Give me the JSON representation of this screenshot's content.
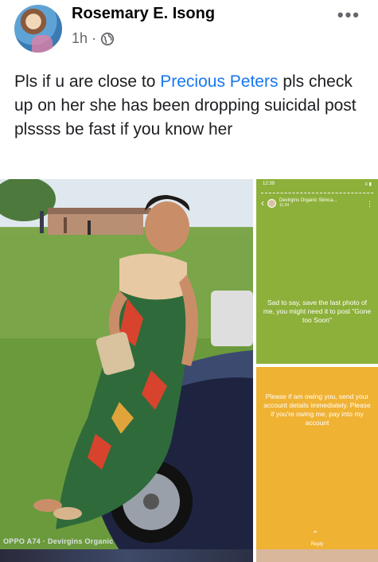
{
  "post": {
    "author": "Rosemary E. Isong",
    "time": "1h",
    "separator": "·",
    "more": "•••",
    "text_before": "Pls if u are close to ",
    "mention": "Precious Peters",
    "text_after": " pls check up on her she has been dropping suicidal post plssss be fast if you know her"
  },
  "photos": {
    "main_watermark": "OPPO A74 · Devirgins Organic",
    "story1": {
      "status_time": "12:39",
      "status_icons": "≡ ▮",
      "name": "Devirgins Organic Skinca...",
      "time": "11:34",
      "more": "⋮",
      "back": "‹",
      "message": "Sad to say, save the last photo of me, you might need it to post \"Gone too Soon\""
    },
    "story2": {
      "message": "Please if am owing you, send your account details immediately. Please if you're owing me, pay into my account",
      "reply_icon": "⌃",
      "reply_label": "Reply"
    }
  },
  "colors": {
    "mention": "#1877f2",
    "story_green": "#8db03a",
    "story_yellow": "#f0b233"
  }
}
